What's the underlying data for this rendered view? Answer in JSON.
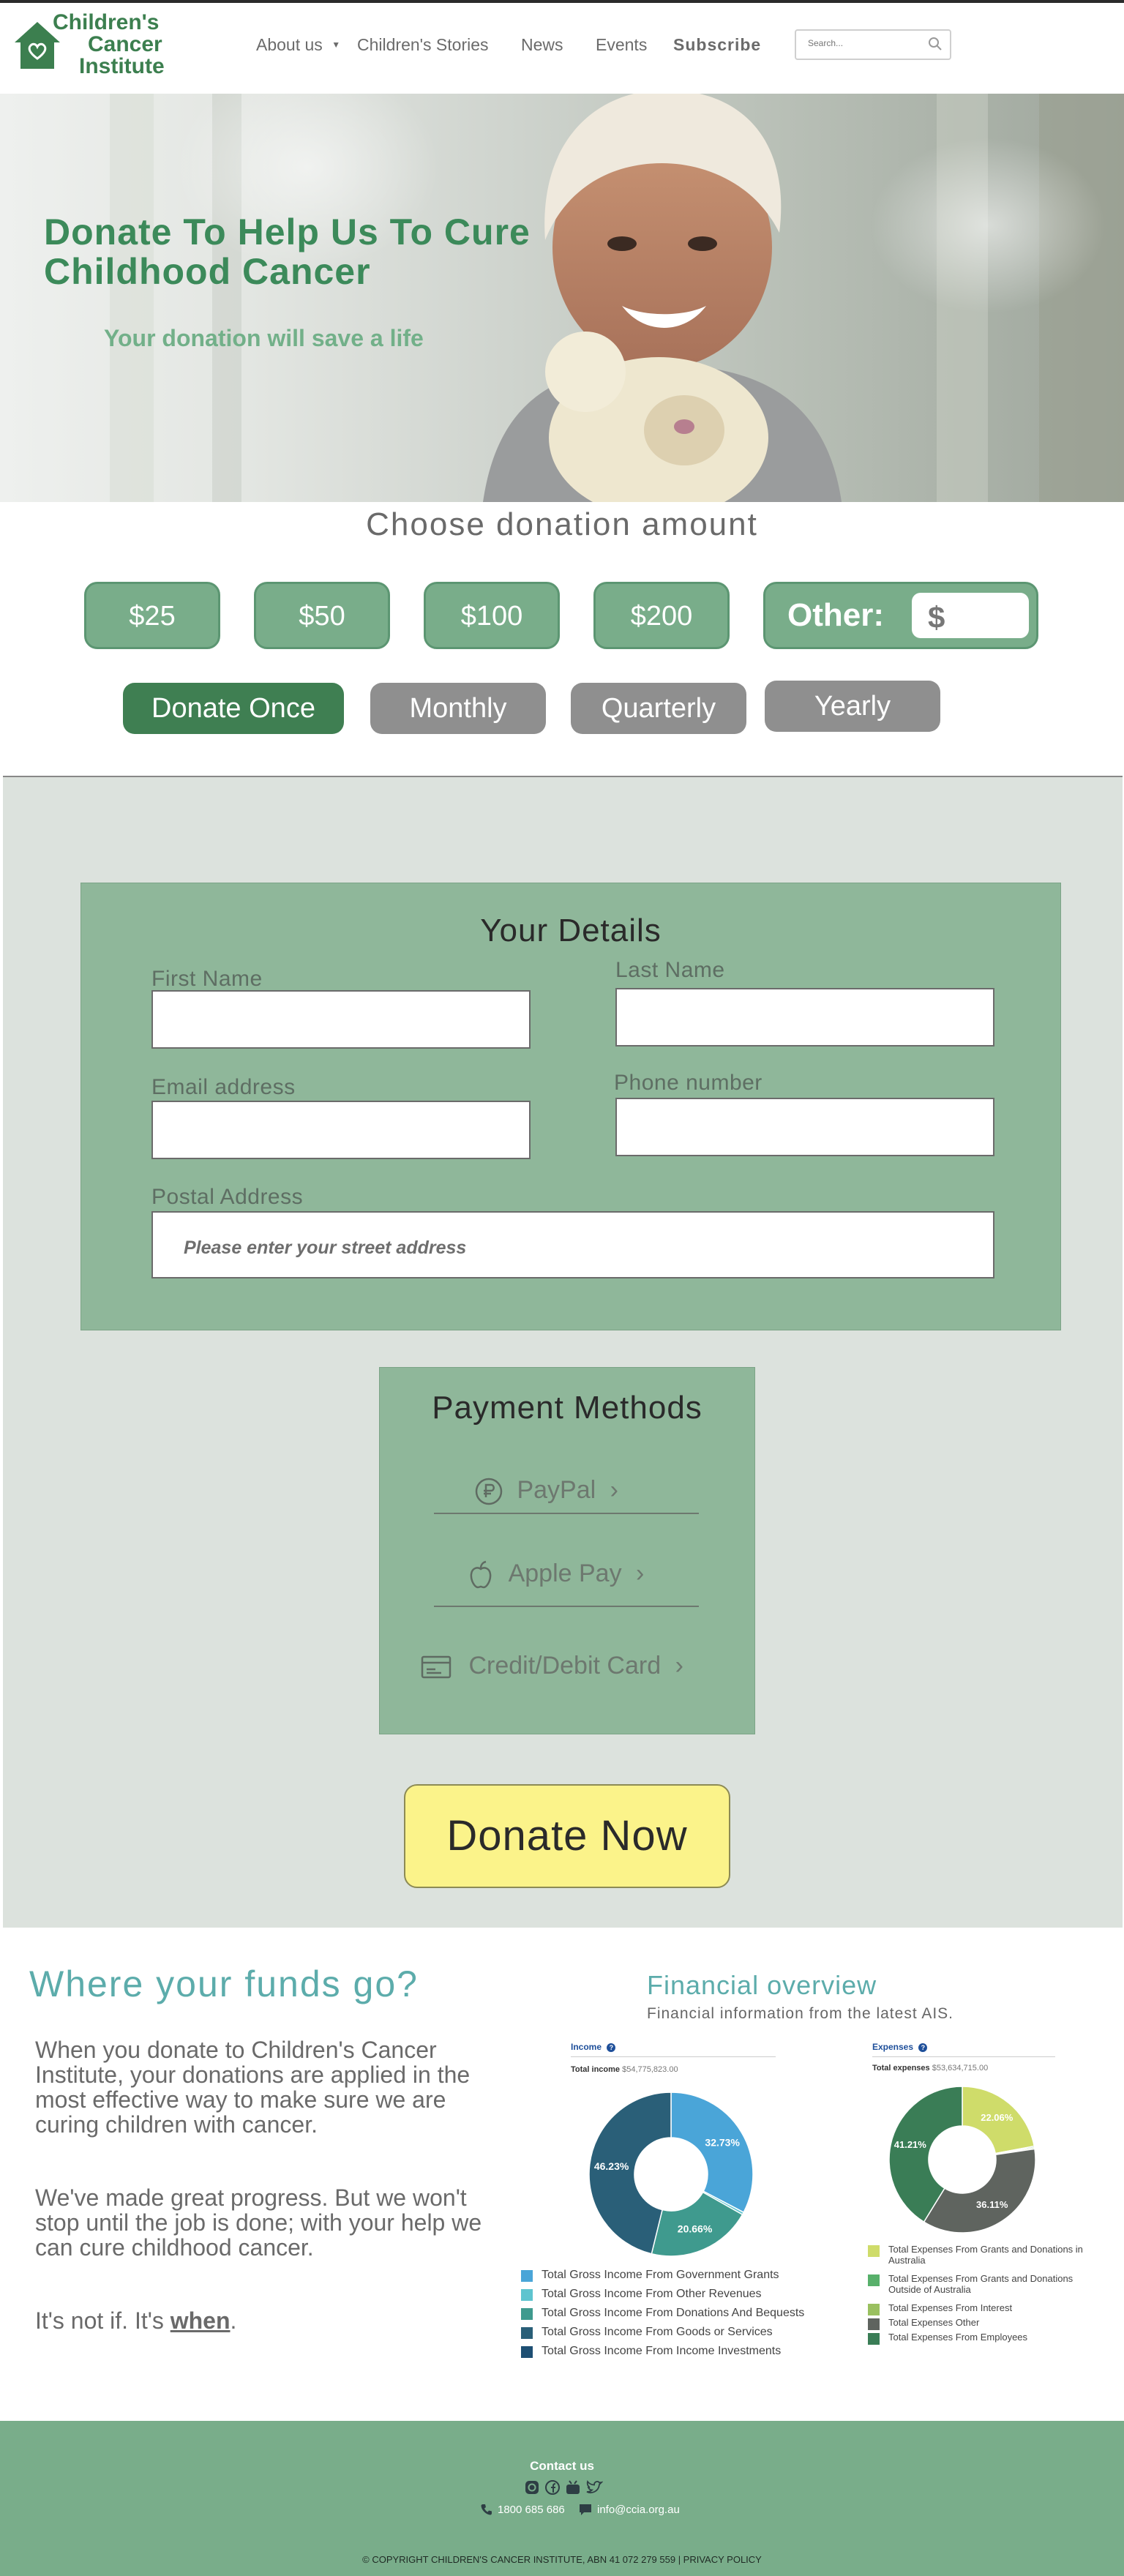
{
  "logo": {
    "lines": [
      "Children's",
      "Cancer",
      "Institute"
    ]
  },
  "nav": {
    "about": "About us",
    "stories": "Children's Stories",
    "news": "News",
    "events": "Events",
    "subscribe": "Subscribe"
  },
  "search": {
    "placeholder": "Search..."
  },
  "hero": {
    "title_line1": "Donate To Help Us To Cure",
    "title_line2": "Childhood Cancer",
    "subtitle": "Your donation will save a life"
  },
  "donation": {
    "heading": "Choose donation amount",
    "amounts": [
      "$25",
      "$50",
      "$100",
      "$200"
    ],
    "other_label": "Other:",
    "currency_symbol": "$",
    "frequencies": [
      "Donate Once",
      "Monthly",
      "Quarterly",
      "Yearly"
    ],
    "selected_frequency": "Donate Once"
  },
  "details": {
    "heading": "Your Details",
    "first_name": "First Name",
    "last_name": "Last Name",
    "email": "Email address",
    "phone": "Phone number",
    "postal": "Postal Address",
    "postal_placeholder": "Please enter your street address"
  },
  "payment": {
    "heading": "Payment Methods",
    "paypal": "PayPal",
    "apple_pay": "Apple Pay",
    "card": "Credit/Debit Card",
    "chevron": "›"
  },
  "donate_now": "Donate Now",
  "funds": {
    "heading": "Where your funds go?",
    "para1": "When you donate to Children's Cancer Institute, your donations are applied in the most effective way to make sure we are curing children with cancer.",
    "para2": "We've made great progress. But we won't stop until the job is done; with your help we can cure childhood cancer.",
    "para3_prefix": "It's not if. It's ",
    "para3_emph": "when",
    "para3_suffix": "."
  },
  "overview": {
    "heading": "Financial overview",
    "subheading": "Financial information from the latest AIS.",
    "income_tab": "Income",
    "income_total_label": "Total income",
    "income_total_value": "$54,775,823.00",
    "expenses_tab": "Expenses",
    "expenses_total_label": "Total expenses",
    "expenses_total_value": "$53,634,715.00",
    "info_icon": "?"
  },
  "chart_data": [
    {
      "type": "pie",
      "title": "Income",
      "categories": [
        "Total Gross Income From Government Grants",
        "Total Gross Income From Other Revenues",
        "Total Gross Income From Donations And Bequests",
        "Total Gross Income From Goods or Services",
        "Total Gross Income From Income Investments"
      ],
      "values": [
        32.73,
        0.5,
        20.66,
        46.23,
        0.0
      ],
      "labels": [
        "32.73%",
        "",
        "20.66%",
        "46.23%",
        ""
      ],
      "colors": [
        "#4aa5d8",
        "#5ec4cf",
        "#3f9a8e",
        "#2a5f78",
        "#1e4f73"
      ],
      "legend": "bottom"
    },
    {
      "type": "pie",
      "title": "Expenses",
      "categories": [
        "Total Expenses From Grants and Donations in Australia",
        "Total Expenses From Grants and Donations Outside of Australia",
        "Total Expenses From Interest",
        "Total Expenses Other",
        "Total Expenses From Employees"
      ],
      "values": [
        22.06,
        0.3,
        0.3,
        36.11,
        41.21
      ],
      "labels": [
        "22.06%",
        "",
        "",
        "36.11%",
        "41.21%"
      ],
      "colors": [
        "#cfdc6a",
        "#58b06b",
        "#9ac060",
        "#5f645f",
        "#3a7d56"
      ],
      "legend": "bottom"
    }
  ],
  "footer": {
    "contact_heading": "Contact us",
    "phone": "1800 685 686",
    "email": "info@ccia.org.au",
    "copyright": "© COPYRIGHT CHILDREN'S CANCER INSTITUTE, ABN 41 072 279 559 | PRIVACY POLICY"
  }
}
